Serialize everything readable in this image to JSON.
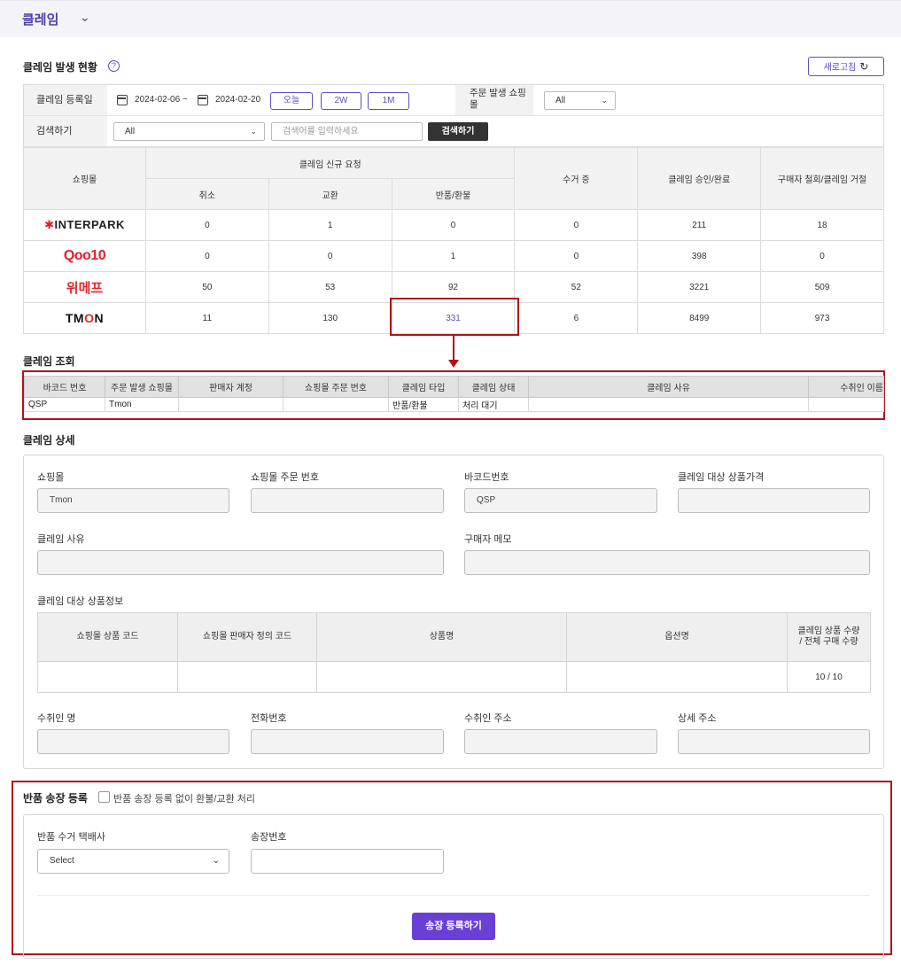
{
  "header": {
    "title": "클레임",
    "chevron_icon": "chevron-down-icon"
  },
  "status_section": {
    "title": "클레임 발생 현황",
    "help_icon": "question-circle-icon",
    "help_glyph": "?",
    "refresh_label": "새로고침",
    "refresh_icon": "refresh-icon",
    "refresh_glyph": "↻"
  },
  "filter": {
    "date_label": "클레임 등록일",
    "start_date": "2024-02-06 ~",
    "end_date": "2024-02-20",
    "period_buttons": [
      "오늘",
      "2W",
      "1M"
    ],
    "shop_label": "주문 발생 쇼핑몰",
    "shop_value": "All",
    "search_label": "검색하기",
    "search_type_value": "All",
    "search_placeholder": "검색어를 입력하세요",
    "search_button": "검색하기",
    "caret": "⌄"
  },
  "stats_table": {
    "headers": {
      "shop": "쇼핑몰",
      "new_requests": "클레임 신규 요청",
      "cancel": "취소",
      "exchange": "교환",
      "return_refund": "반품/환불",
      "collecting": "수거 중",
      "approved": "클레임 승인/완료",
      "rejected": "구매자 철회/클레임 거절"
    },
    "rows": [
      {
        "shop": "INTERPARK",
        "logo_mark": "✱",
        "cancel": "0",
        "exchange": "1",
        "return_refund": "0",
        "collecting": "0",
        "approved": "211",
        "rejected": "18"
      },
      {
        "shop": "Qoo10",
        "cancel": "0",
        "exchange": "0",
        "return_refund": "1",
        "collecting": "0",
        "approved": "398",
        "rejected": "0"
      },
      {
        "shop": "위메프",
        "cancel": "50",
        "exchange": "53",
        "return_refund": "92",
        "collecting": "52",
        "approved": "3221",
        "rejected": "509"
      },
      {
        "shop_a": "TM",
        "shop_b": "O",
        "shop_c": "N",
        "cancel": "11",
        "exchange": "130",
        "return_refund": "331",
        "collecting": "6",
        "approved": "8499",
        "rejected": "973"
      }
    ]
  },
  "claims_section": {
    "title": "클레임 조회",
    "headers": [
      "바코드 번호",
      "주문 발생 쇼핑몰",
      "판매자 계정",
      "쇼핑몰 주문 번호",
      "클레임 타입",
      "클레임 상태",
      "클레임 사유",
      "수취인 이름"
    ],
    "row": [
      "QSP",
      "Tmon",
      "",
      "",
      "반품/환불",
      "처리 대기",
      "",
      ""
    ]
  },
  "detail_section": {
    "title": "클레임 상세",
    "shop_label": "쇼핑몰",
    "shop_value": "Tmon",
    "order_no_label": "쇼핑몰 주문 번호",
    "order_no_value": "",
    "barcode_label": "바코드번호",
    "barcode_value": "QSP",
    "price_label": "클레임 대상 상품가격",
    "price_value": "",
    "reason_label": "클레임 사유",
    "reason_value": "",
    "memo_label": "구매자 메모",
    "memo_value": "",
    "product_info_label": "클레임 대상 상품정보",
    "product_headers": [
      "쇼핑몰 상품 코드",
      "쇼핑몰 판매자 정의 코드",
      "상품명",
      "옵션명",
      "클레임 상품 수량\n/ 전체 구매 수량"
    ],
    "product_row": [
      "",
      "",
      "",
      "",
      "10 / 10"
    ],
    "receiver_label": "수취인 명",
    "phone_label": "전화번호",
    "address_label": "수취인 주소",
    "detail_address_label": "상세 주소"
  },
  "return_section": {
    "title": "반품 송장 등록",
    "checkbox_label": "반품 송장 등록 없이 환불/교환 처리",
    "courier_label": "반품 수거 택배사",
    "courier_value": "Select",
    "invoice_label": "송장번호",
    "invoice_value": "",
    "submit_label": "송장 등록하기"
  },
  "colors": {
    "accent": "#5b4fc4",
    "highlight_red": "#b0141c",
    "submit": "#6a3fd6"
  }
}
